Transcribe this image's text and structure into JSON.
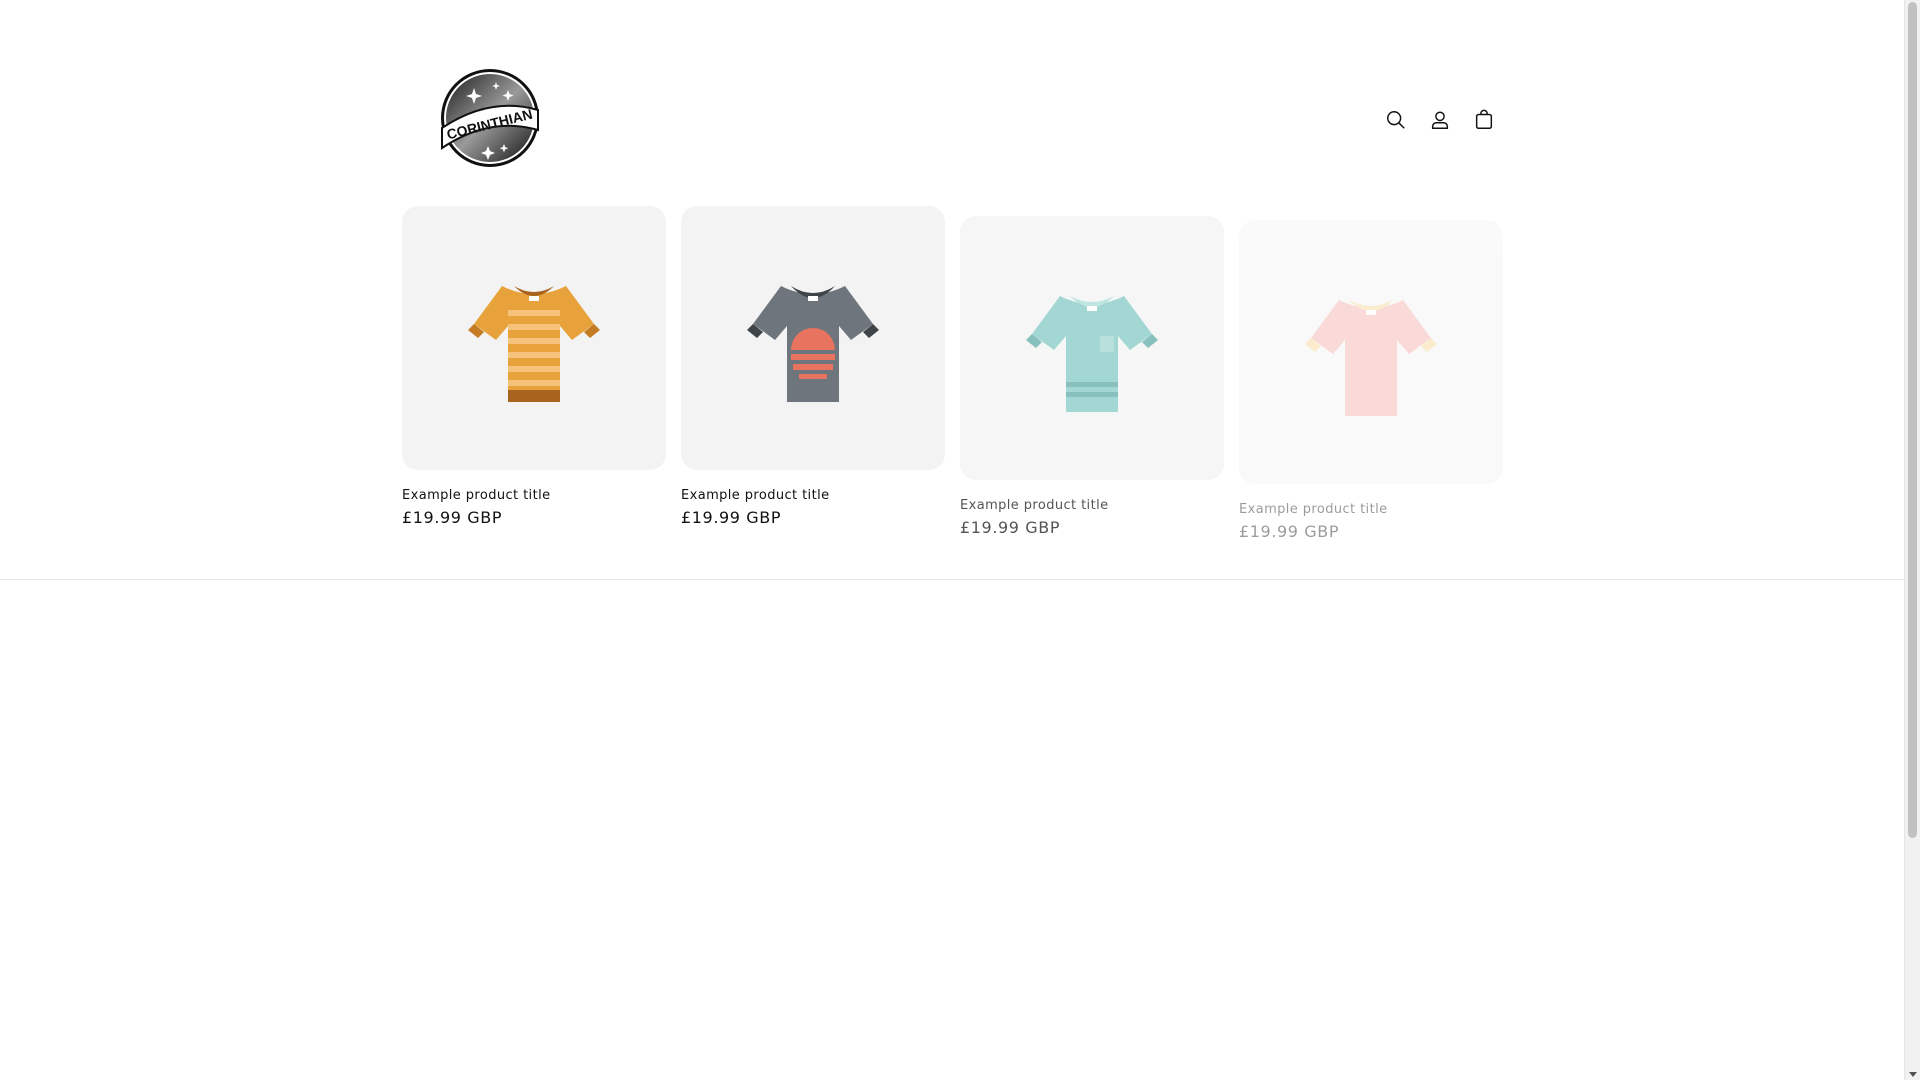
{
  "header": {
    "logo_alt": "CORINTHIAN",
    "icons": [
      "search-icon",
      "account-icon",
      "cart-icon"
    ]
  },
  "products": [
    {
      "title": "Example product title",
      "price": "£19.99 GBP",
      "shirt": "orange-striped-tshirt",
      "color": "#e8a23c"
    },
    {
      "title": "Example product title",
      "price": "£19.99 GBP",
      "shirt": "grey-sunset-tshirt",
      "color": "#6f757c"
    },
    {
      "title": "Example product title",
      "price": "£19.99 GBP",
      "shirt": "teal-pocket-tshirt",
      "color": "#7fc8c4"
    },
    {
      "title": "Example product title",
      "price": "£19.99 GBP",
      "shirt": "pink-tshirt",
      "color": "#f3a8a3"
    }
  ]
}
